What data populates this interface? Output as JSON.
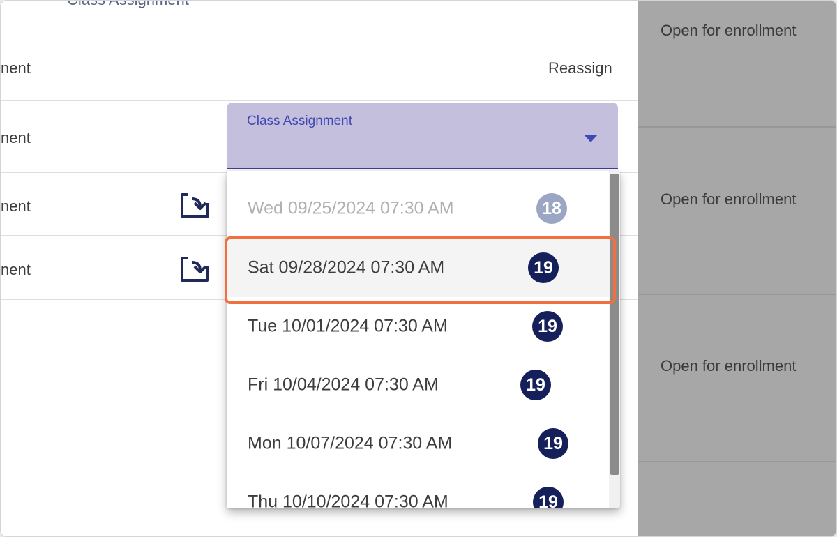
{
  "panel_title": "Class Assignment",
  "columns": {
    "left_partial": "nent",
    "reassign": "Reassign"
  },
  "rows": [
    {
      "left_text": "nent"
    },
    {
      "left_text": "nent"
    },
    {
      "left_text": "nent"
    }
  ],
  "select": {
    "label": "Class Assignment"
  },
  "options": [
    {
      "label": "Wed 09/25/2024 07:30 AM",
      "count": "18",
      "state": "disabled"
    },
    {
      "label": "Sat 09/28/2024 07:30 AM",
      "count": "19",
      "state": "highlighted"
    },
    {
      "label": "Tue 10/01/2024 07:30 AM",
      "count": "19",
      "state": "normal"
    },
    {
      "label": "Fri 10/04/2024 07:30 AM",
      "count": "19",
      "state": "normal"
    },
    {
      "label": "Mon 10/07/2024 07:30 AM",
      "count": "19",
      "state": "normal"
    },
    {
      "label": "Thu 10/10/2024 07:30 AM",
      "count": "19",
      "state": "normal"
    }
  ],
  "status_cells": [
    {
      "text": "Open for enrollment"
    },
    {
      "text": "Open for enrollment"
    },
    {
      "text": "Open for enrollment"
    }
  ],
  "colors": {
    "select_fill": "#c4bfdd",
    "label_blue": "#3f48b4",
    "badge_navy": "#15205a",
    "focus_ring": "#f26f3f"
  },
  "icons": [
    "reassign-icon",
    "dropdown-arrow-icon"
  ]
}
